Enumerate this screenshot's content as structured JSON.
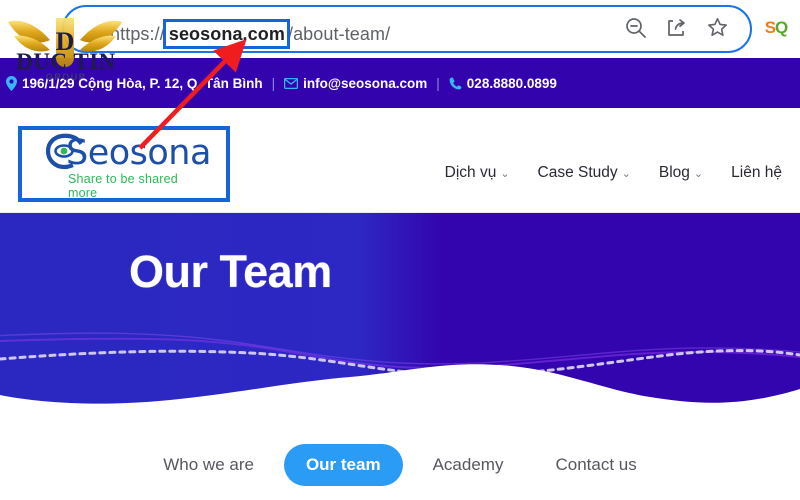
{
  "browser": {
    "url": {
      "scheme": "https://",
      "host": "seosona.com",
      "path": "/about-team/",
      "full": "https://seosona.com/about-team/"
    },
    "icons": [
      {
        "name": "zoom-out-icon",
        "label": "Zoom out"
      },
      {
        "name": "share-icon",
        "label": "Share this page"
      },
      {
        "name": "bookmark-star-icon",
        "label": "Bookmark this tab"
      }
    ],
    "extension": {
      "name": "seoquake-extension-icon",
      "label_left": "S",
      "label_right": "Q"
    }
  },
  "watermark": {
    "title": "DUC TIN",
    "subtitle": "GROUP"
  },
  "contact_bar": {
    "background": "#3304ae",
    "address": {
      "icon": "location-pin-icon",
      "text": "196/1/29 Cộng Hòa, P. 12, Q. Tân Bình"
    },
    "email": {
      "icon": "envelope-icon",
      "text": "info@seosona.com"
    },
    "phone": {
      "icon": "phone-icon",
      "text": "028.8880.0899"
    },
    "separator": "|"
  },
  "site_header": {
    "logo": {
      "name": "seosona-logo",
      "wordmark": "Seosona",
      "tagline": "Share to be shared more",
      "color": "#1b4fa8",
      "tagline_color": "#2fb855"
    },
    "nav": [
      {
        "label": "Dịch vụ",
        "has_dropdown": true,
        "caret": "⌄"
      },
      {
        "label": "Case Study",
        "has_dropdown": true,
        "caret": "⌄"
      },
      {
        "label": "Blog",
        "has_dropdown": true,
        "caret": "⌄"
      },
      {
        "label": "Liên hệ",
        "has_dropdown": false,
        "caret": ""
      }
    ]
  },
  "hero": {
    "title": "Our Team",
    "gradient_left": "#2a28c0",
    "gradient_right": "#3305ae",
    "dotted_line_color": "#cfc6ef"
  },
  "tabs": {
    "active_color": "#2b9cf5",
    "items": [
      {
        "label": "Who we are",
        "active": false
      },
      {
        "label": "Our team",
        "active": true
      },
      {
        "label": "Academy",
        "active": false
      },
      {
        "label": "Contact us",
        "active": false
      }
    ]
  },
  "annotations": {
    "url_highlight_box": {
      "color": "#1565d8",
      "target": "seosona.com"
    },
    "logo_highlight_box": {
      "color": "#1565d8",
      "target": "seosona-logo"
    },
    "arrow": {
      "color": "#ef1d1d",
      "from": "logo-highlight-box",
      "to": "url-highlight-box"
    }
  }
}
